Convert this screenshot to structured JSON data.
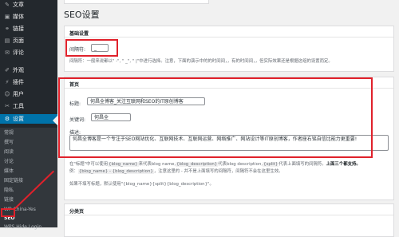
{
  "sidebar": {
    "items": [
      {
        "label": "文章",
        "icon": "pin-icon",
        "glyph": "✎"
      },
      {
        "label": "媒体",
        "icon": "media-icon",
        "glyph": "▣"
      },
      {
        "label": "链接",
        "icon": "link-icon",
        "glyph": "⚭"
      },
      {
        "label": "页面",
        "icon": "page-icon",
        "glyph": "▤"
      },
      {
        "label": "评论",
        "icon": "comment-icon",
        "glyph": "✉"
      },
      {
        "label": "外观",
        "icon": "brush-icon",
        "glyph": "✐"
      },
      {
        "label": "插件",
        "icon": "plugin-icon",
        "glyph": "⚡"
      },
      {
        "label": "用户",
        "icon": "user-icon",
        "glyph": "☺"
      },
      {
        "label": "工具",
        "icon": "wrench-icon",
        "glyph": "✂"
      },
      {
        "label": "设置",
        "icon": "settings-icon",
        "glyph": "⚙"
      }
    ],
    "submenu": [
      "常规",
      "撰写",
      "阅读",
      "讨论",
      "媒体",
      "固定链接",
      "隐私",
      "链接",
      "WP-China-Yes",
      "SEO",
      "WPS Hide Login"
    ]
  },
  "page": {
    "title": "SEO设置",
    "basic": {
      "title": "基础设置",
      "separator_label": "间隔符:",
      "separator_value": "_",
      "desc": "间隔符：一般来说都以\" -\", \" _\", \" |\"中进行选择。注意，下面的演示中的的时间间，，有的时间间，，但实际效果还是根据这组的设置而定。"
    },
    "home": {
      "title": "首页",
      "title_label": "标题:",
      "title_value": "何昌全博客_关注互联网和SEO的IT原创博客",
      "keywords_label": "关键词:",
      "keywords_value": "何昌全",
      "description_label": "描述:",
      "description_value": "何昌全博客是一个专注于SEO网站优化、互联网技术、互联网运营、网络推广、网站设计等IT原创博客，作者座右铭自信比能力更重要!"
    },
    "notes": {
      "line1_a": "在\"标题\"中可以使用",
      "code_blog_name": "{blog_name}",
      "line1_b": "来代表blog name,",
      "code_blog_description": "{blog_description}",
      "line1_c": "代表blog description,",
      "code_split": "{split}",
      "line1_d": "代表上面填写的间隔符。",
      "line1_bold": "上面三个都支持。",
      "line2_a": "例：",
      "code_example": "{blog_name} - {blog_description}",
      "line2_b": "，注意这里的 - 并不是上面填写的间隔符，间隔符不会在这里生效。",
      "line3": "如果不填写标题，默认使用\"{blog_name}{split}{blog_description}\"。"
    },
    "category": {
      "title": "分类页"
    }
  }
}
